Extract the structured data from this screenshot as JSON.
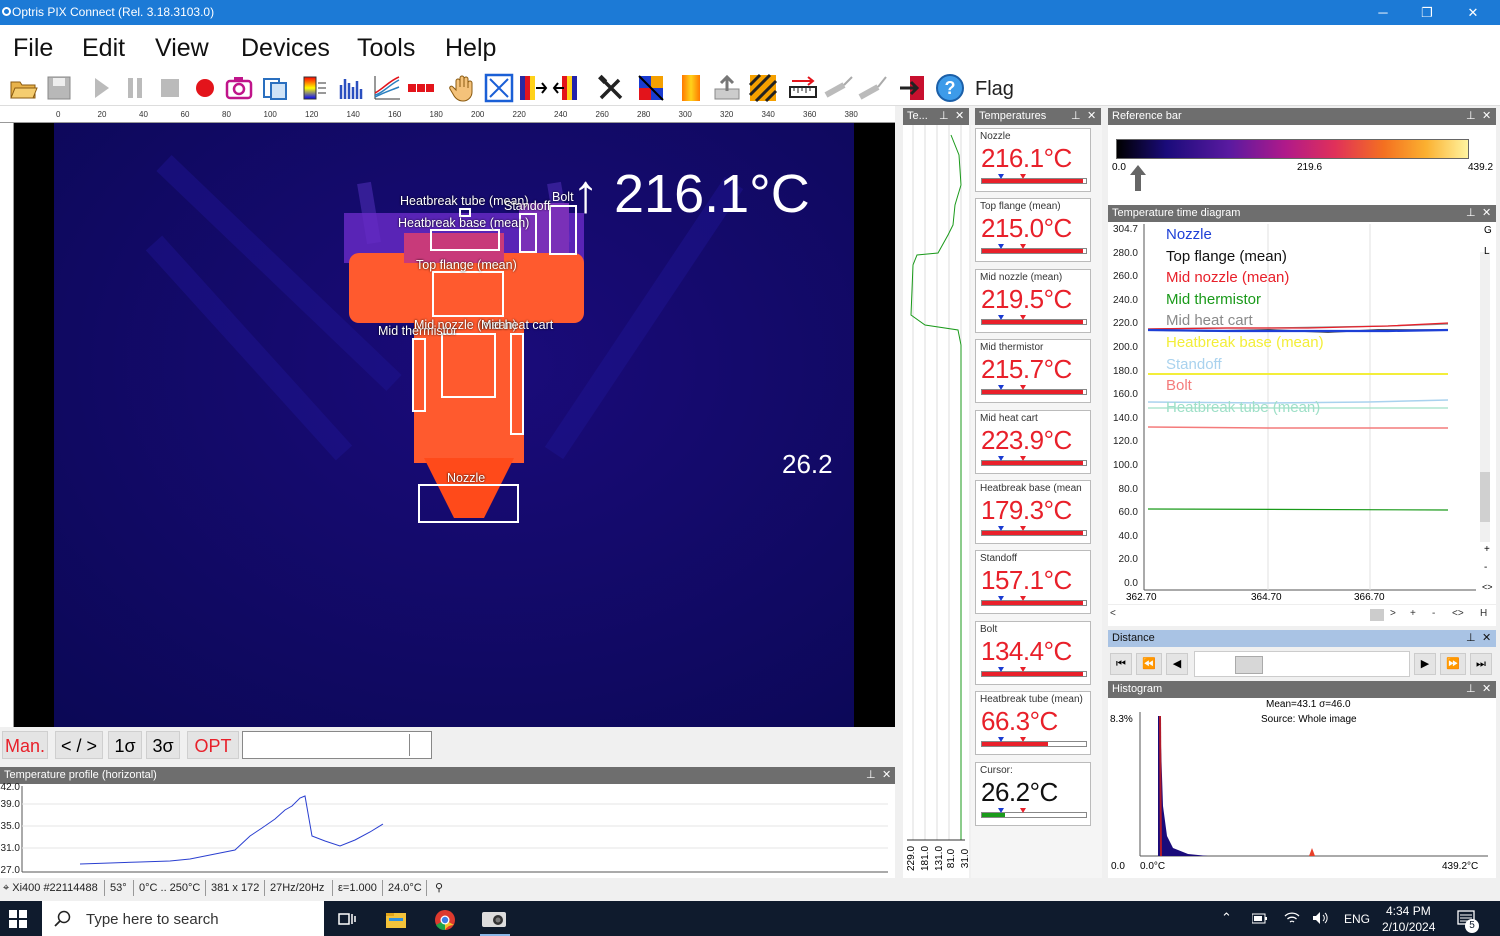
{
  "window": {
    "title": "Optris PIX Connect (Rel. 3.18.3103.0)",
    "min": "─",
    "restore": "❐",
    "close": "✕"
  },
  "menu": [
    "File",
    "Edit",
    "View",
    "Devices",
    "Tools",
    "Help"
  ],
  "toolbar": {
    "flag_label": "Flag",
    "icons": [
      "open-folder-icon",
      "save-icon",
      "play-icon",
      "pause-icon",
      "stop-icon",
      "record-icon",
      "camera-icon",
      "copy-icon",
      "palette-icon",
      "histogram-icon",
      "graph-icon",
      "layout-icon",
      "hand-icon",
      "fit-icon",
      "palette-swap-icon",
      "palette-swap2-icon",
      "tools-icon",
      "grid-icon",
      "flame-icon",
      "upload-icon",
      "hatch-icon",
      "measure-icon",
      "probe-icon",
      "probe2-icon",
      "exit-icon",
      "help-icon"
    ]
  },
  "ruler": {
    "ticks": [
      "0",
      "20",
      "40",
      "60",
      "80",
      "100",
      "120",
      "140",
      "160",
      "180",
      "200",
      "220",
      "240",
      "260",
      "280",
      "300",
      "320",
      "340",
      "360",
      "380"
    ]
  },
  "thermal": {
    "big_temp": "↑ 216.1°C",
    "cursor_temp": "26.2",
    "rois": [
      {
        "label": "Heatbreak tube (mean)"
      },
      {
        "label": "Heatbreak base (mean)"
      },
      {
        "label": "Standoff"
      },
      {
        "label": "Bolt"
      },
      {
        "label": "Top flange (mean)"
      },
      {
        "label": "Mid thermistor"
      },
      {
        "label": "Mid nozzle (mean)"
      },
      {
        "label": "Mid heat cart"
      },
      {
        "label": "Nozzle"
      }
    ]
  },
  "controls": {
    "man": "Man.",
    "range": "< / >",
    "sigma1": "1σ",
    "sigma3": "3σ",
    "opt": "OPT"
  },
  "profile": {
    "title": "Temperature profile (horizontal)",
    "ylabels": [
      "42.0",
      "39.0",
      "35.0",
      "31.0",
      "27.0"
    ]
  },
  "narrow_panel": {
    "title": "Te...",
    "labels": [
      "229.0",
      "181.0",
      "131.0",
      "81.0",
      "31.0"
    ]
  },
  "temperatures": {
    "title": "Temperatures",
    "cards": [
      {
        "label": "Nozzle",
        "value": "216.1°C",
        "fill": 0.97
      },
      {
        "label": "Top flange (mean)",
        "value": "215.0°C",
        "fill": 0.97
      },
      {
        "label": "Mid nozzle (mean)",
        "value": "219.5°C",
        "fill": 0.97
      },
      {
        "label": "Mid thermistor",
        "value": "215.7°C",
        "fill": 0.97
      },
      {
        "label": "Mid heat cart",
        "value": "223.9°C",
        "fill": 0.97
      },
      {
        "label": "Heatbreak base (mean",
        "value": "179.3°C",
        "fill": 0.97
      },
      {
        "label": "Standoff",
        "value": "157.1°C",
        "fill": 0.97
      },
      {
        "label": "Bolt",
        "value": "134.4°C",
        "fill": 0.97
      },
      {
        "label": "Heatbreak tube (mean)",
        "value": "66.3°C",
        "fill": 0.63
      },
      {
        "label": "Cursor:",
        "value": "26.2°C",
        "fill": 0.22
      }
    ]
  },
  "reference_bar": {
    "title": "Reference bar",
    "min": "0.0",
    "mid": "219.6",
    "max": "439.2"
  },
  "time_diagram": {
    "title": "Temperature time diagram",
    "ylabels": [
      "304.7",
      "280.0",
      "260.0",
      "240.0",
      "220.0",
      "200.0",
      "180.0",
      "160.0",
      "140.0",
      "120.0",
      "100.0",
      "80.0",
      "60.0",
      "40.0",
      "20.0",
      "0.0"
    ],
    "xlabels": [
      "362.70",
      "364.70",
      "366.70"
    ],
    "right_letters": [
      "G",
      "L",
      "+",
      "-",
      "<>",
      "H"
    ],
    "legend": [
      {
        "name": "Nozzle",
        "color": "#1d3fd6"
      },
      {
        "name": "Top flange (mean)",
        "color": "#111111"
      },
      {
        "name": "Mid nozzle (mean)",
        "color": "#e8202a"
      },
      {
        "name": "Mid thermistor",
        "color": "#1a9a1a"
      },
      {
        "name": "Mid heat cart",
        "color": "#8a8a8a"
      },
      {
        "name": "Heatbreak base (mean)",
        "color": "#f3ee3a"
      },
      {
        "name": "Standoff",
        "color": "#a9d2ee"
      },
      {
        "name": "Bolt",
        "color": "#f47b7b"
      },
      {
        "name": "Heatbreak tube (mean)",
        "color": "#9fe0c8"
      }
    ],
    "scroll_controls": [
      "<",
      ">",
      "+",
      "-",
      "<>",
      "H"
    ]
  },
  "distance": {
    "title": "Distance"
  },
  "histogram": {
    "title": "Histogram",
    "stats": "Mean=43.1 σ=46.0",
    "source": "Source:  Whole image",
    "percent": "8.3%",
    "xmin": "0.0",
    "xmin2": "0.0°C",
    "xmax": "439.2°C"
  },
  "statusbar": [
    "Xi400 #22114488",
    "53°",
    "0°C .. 250°C",
    "381 x 172",
    "27Hz/20Hz",
    "ε=1.000",
    "24.0°C"
  ],
  "taskbar": {
    "search": "Type here to search",
    "lang": "ENG",
    "time": "4:34 PM",
    "date": "2/10/2024",
    "notif": "5"
  }
}
